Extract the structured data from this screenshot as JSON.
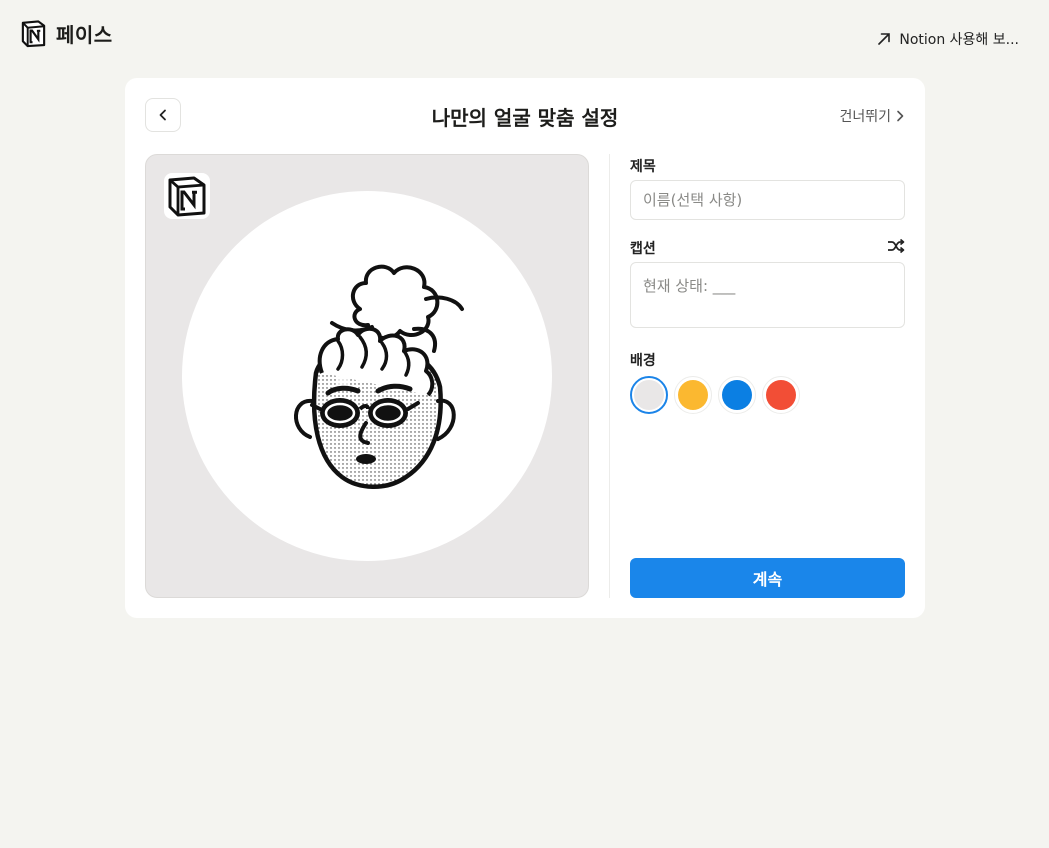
{
  "header": {
    "brand_title": "페이스",
    "brand_logo_icon": "notion-logo-icon",
    "try_notion_label": "Notion 사용해 보...",
    "try_notion_icon": "arrow-up-right-icon"
  },
  "card": {
    "title": "나만의 얼굴 맞춤 설정",
    "back_icon": "chevron-left-icon",
    "skip_label": "건너뛰기",
    "skip_icon": "chevron-right-icon"
  },
  "preview": {
    "corner_logo_icon": "notion-logo-icon",
    "avatar": "illustrated-face-with-sunglasses"
  },
  "form": {
    "title_label": "제목",
    "title_value": "",
    "title_placeholder": "이름(선택 사항)",
    "caption_label": "캡션",
    "caption_value": "",
    "caption_placeholder": "현재 상태: ___",
    "shuffle_icon": "shuffle-icon",
    "background_label": "배경",
    "background_options": [
      {
        "name": "gray",
        "color": "#e9e7e7",
        "selected": true
      },
      {
        "name": "yellow",
        "color": "#fbb830",
        "selected": false
      },
      {
        "name": "blue",
        "color": "#0b7fe3",
        "selected": false
      },
      {
        "name": "red",
        "color": "#f24e36",
        "selected": false
      }
    ],
    "continue_label": "계속"
  },
  "colors": {
    "page_background": "#f4f4f0",
    "accent": "#1a86ea",
    "selection_ring": "#1b84e8"
  }
}
